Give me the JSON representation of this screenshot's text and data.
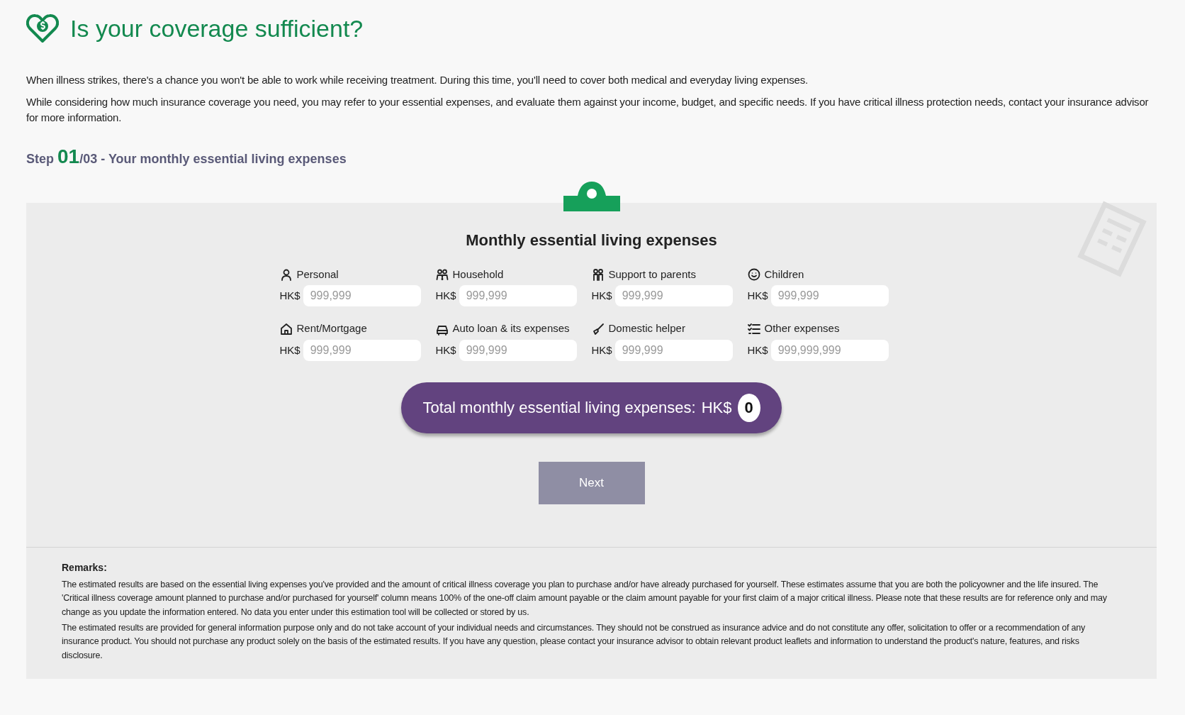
{
  "title": "Is your coverage sufficient?",
  "intro": [
    "When illness strikes, there's a chance you won't be able to work while receiving treatment. During this time, you'll need to cover both medical and everyday living expenses.",
    "While considering how much insurance coverage you need, you may refer to your essential expenses, and evaluate them against your income, budget, and specific needs. If you have critical illness protection needs, contact your insurance advisor for more information."
  ],
  "step": {
    "label": "Step",
    "current": "01",
    "total": "/03 - Your monthly essential living expenses"
  },
  "panel": {
    "heading": "Monthly essential living expenses",
    "fields": [
      {
        "label": "Personal",
        "currency": "HK$",
        "placeholder": "999,999"
      },
      {
        "label": "Household",
        "currency": "HK$",
        "placeholder": "999,999"
      },
      {
        "label": "Support to parents",
        "currency": "HK$",
        "placeholder": "999,999"
      },
      {
        "label": "Children",
        "currency": "HK$",
        "placeholder": "999,999"
      },
      {
        "label": "Rent/Mortgage",
        "currency": "HK$",
        "placeholder": "999,999"
      },
      {
        "label": "Auto loan & its expenses",
        "currency": "HK$",
        "placeholder": "999,999"
      },
      {
        "label": "Domestic helper",
        "currency": "HK$",
        "placeholder": "999,999"
      },
      {
        "label": "Other expenses",
        "currency": "HK$",
        "placeholder": "999,999,999"
      }
    ],
    "total": {
      "label": "Total monthly essential living expenses:",
      "currency": "HK$",
      "value": "0"
    },
    "next_button": {
      "label": "Next",
      "disabled": true
    }
  },
  "remarks": {
    "title": "Remarks:",
    "paragraphs": [
      "The estimated results are based on the essential living expenses you've provided and the amount of critical illness coverage you plan to purchase and/or have already purchased for yourself. These estimates assume that you are both the policyowner and the life insured. The 'Critical illness coverage amount planned to purchase and/or purchased for yourself' column means 100% of the one-off claim amount payable or the claim amount payable for your first claim of a major critical illness. Please note that these results are for reference only and may change as you update the information entered. No data you enter under this estimation tool will be collected or stored by us.",
      "The estimated results are provided for general information purpose only and do not take account of your individual needs and circumstances. They should not be construed as insurance advice and do not constitute any offer, solicitation to offer or a recommendation of any insurance product. You should not purchase any product solely on the basis of the estimated results. If you have any question, please contact your insurance advisor to obtain relevant product leaflets and information to understand the product's nature, features, and risks disclosure."
    ]
  }
}
